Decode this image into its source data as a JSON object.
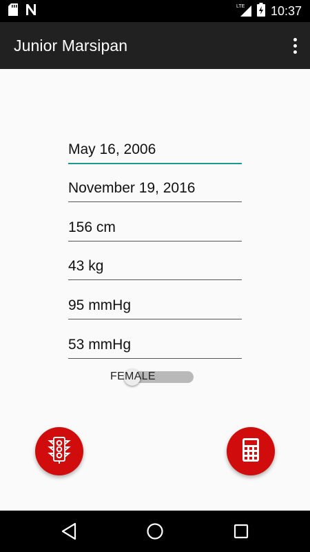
{
  "status_bar": {
    "time": "10:37",
    "network_label": "LTE",
    "icons": [
      "sd-card-icon",
      "notification-n-icon",
      "lte-signal-icon",
      "battery-charging-icon"
    ]
  },
  "app_bar": {
    "title": "Junior Marsipan",
    "overflow_icon": "more-vert-icon"
  },
  "form": {
    "birth_date": "May 16, 2006",
    "measurement_date": "November 19, 2016",
    "height": "156 cm",
    "weight": "43 kg",
    "systolic": "95 mmHg",
    "diastolic": "53 mmHg",
    "sex_label": "FEMALE",
    "sex_switch_on": false
  },
  "actions": {
    "left_icon": "traffic-light-icon",
    "right_icon": "calculator-icon"
  },
  "nav": {
    "icons": [
      "back-icon",
      "home-icon",
      "recents-icon"
    ]
  },
  "colors": {
    "app_bar": "#212121",
    "accent": "#1a9a8a",
    "fab": "#d00c0c",
    "background": "#fafafa"
  }
}
